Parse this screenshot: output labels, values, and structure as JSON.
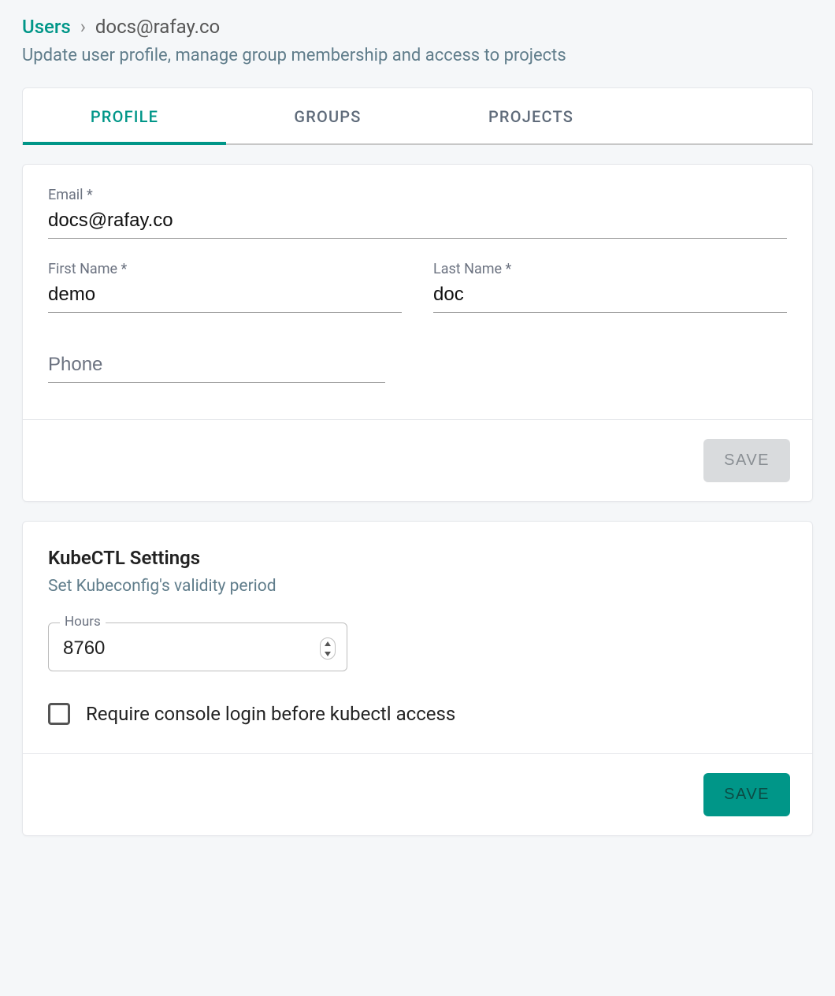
{
  "breadcrumb": {
    "root": "Users",
    "separator": "›",
    "current": "docs@rafay.co"
  },
  "subtitle": "Update user profile, manage group membership and access to projects",
  "tabs": [
    {
      "id": "profile",
      "label": "PROFILE",
      "active": true
    },
    {
      "id": "groups",
      "label": "GROUPS",
      "active": false
    },
    {
      "id": "projects",
      "label": "PROJECTS",
      "active": false
    }
  ],
  "profileForm": {
    "email": {
      "label": "Email *",
      "value": "docs@rafay.co"
    },
    "firstName": {
      "label": "First Name *",
      "value": "demo"
    },
    "lastName": {
      "label": "Last Name *",
      "value": "doc"
    },
    "phone": {
      "label": "Phone",
      "value": ""
    },
    "saveLabel": "SAVE"
  },
  "kubectl": {
    "title": "KubeCTL Settings",
    "subtitle": "Set Kubeconfig's validity period",
    "hours": {
      "label": "Hours",
      "value": "8760"
    },
    "requireLogin": {
      "label": "Require console login before kubectl access",
      "checked": false
    },
    "saveLabel": "SAVE"
  }
}
